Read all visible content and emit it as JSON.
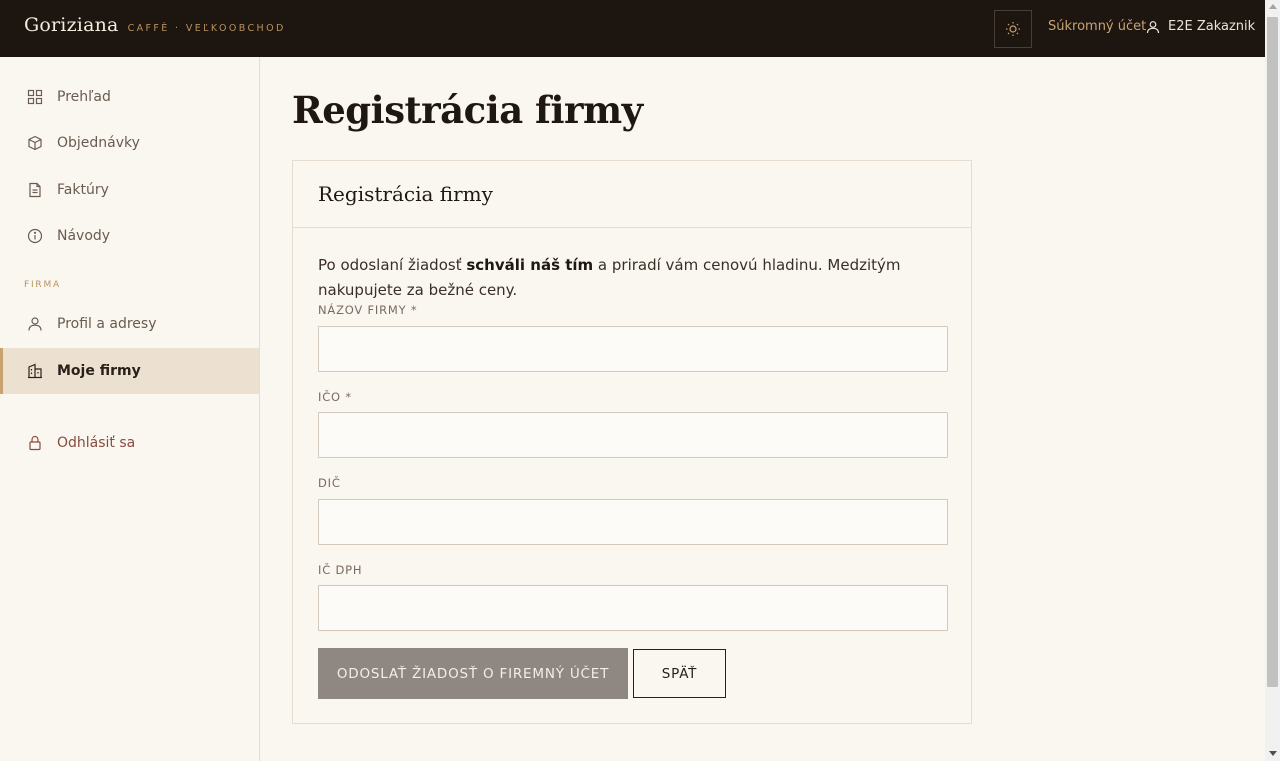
{
  "brand": {
    "name": "Goriziana",
    "subtitle": "CAFFÈ · VEĽKOOBCHOD"
  },
  "topbar": {
    "theme_icon": "sun-icon",
    "private_account_label": "Súkromný účet",
    "user_icon": "user-icon",
    "user_name": "E2E Zakaznik",
    "accent_color": "#c9a36f",
    "background_color": "#1d1510"
  },
  "sidebar": {
    "items": [
      {
        "label": "Prehľad",
        "icon": "grid-icon"
      },
      {
        "label": "Objednávky",
        "icon": "box-icon"
      },
      {
        "label": "Faktúry",
        "icon": "document-icon"
      },
      {
        "label": "Návody",
        "icon": "info-icon"
      }
    ],
    "section_label": "FIRMA",
    "section_items": [
      {
        "label": "Profil a adresy",
        "icon": "user-icon"
      },
      {
        "label": "Moje firmy",
        "icon": "building-icon",
        "active": true
      }
    ],
    "logout_label": "Odhlásiť sa",
    "logout_icon": "lock-icon",
    "active_color": "#ece1d1"
  },
  "main": {
    "page_title": "Registrácia firmy",
    "card_title": "Registrácia firmy",
    "intro_before": "Po odoslaní žiadosť ",
    "intro_bold": "schváli náš tím",
    "intro_after": " a priradí vám cenovú hladinu. Medzitým nakupujete za bežné ceny.",
    "fields": [
      {
        "label": "NÁZOV FIRMY *",
        "value": "",
        "placeholder": ""
      },
      {
        "label": "IČO *",
        "value": "",
        "placeholder": ""
      },
      {
        "label": "DIČ",
        "value": "",
        "placeholder": ""
      },
      {
        "label": "IČ DPH",
        "value": "",
        "placeholder": ""
      }
    ],
    "submit_label": "ODOSLAŤ ŽIADOSŤ O FIREMNÝ ÚČET",
    "back_label": "SPÄŤ",
    "submit_color": "#8f8781"
  }
}
